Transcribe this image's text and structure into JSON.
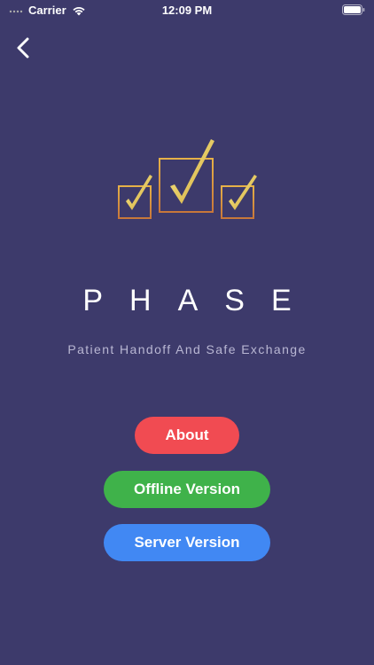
{
  "status_bar": {
    "carrier": "Carrier",
    "time": "12:09 PM",
    "icons": [
      "signal-icon",
      "wifi-icon",
      "battery-icon"
    ]
  },
  "nav": {
    "back_icon": "chevron-left-icon"
  },
  "logo": {
    "icon": "checkbox-checkmarks-logo",
    "colors": {
      "gold_light": "#f5e77a",
      "gold_dark": "#c9a23a",
      "box": "#d08a3a"
    }
  },
  "app": {
    "title": "PHASE",
    "subtitle": "Patient Handoff And Safe Exchange"
  },
  "buttons": {
    "about": "About",
    "offline": "Offline Version",
    "server": "Server Version"
  },
  "colors": {
    "background": "#3d3a6b",
    "about": "#f14b52",
    "offline": "#3fb24a",
    "server": "#4188f3",
    "subtitle": "#b9b7d3"
  }
}
